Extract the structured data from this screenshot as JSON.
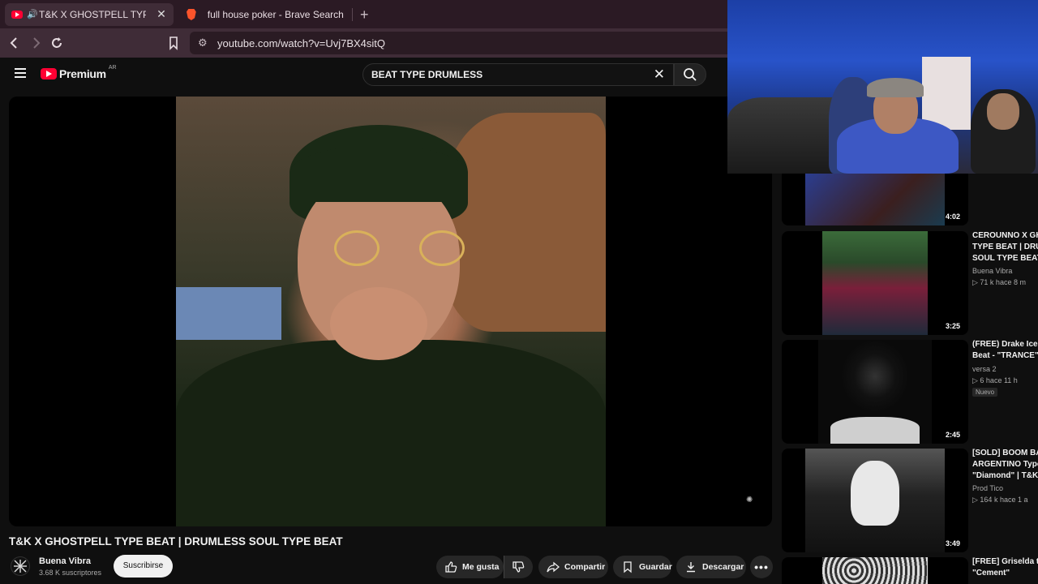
{
  "browser": {
    "tabs": [
      {
        "label": "T&K X GHOSTPELL TYPE BEAT"
      },
      {
        "label": "full house poker - Brave Search"
      }
    ],
    "url": "youtube.com/watch?v=Uvj7BX4sitQ"
  },
  "youtube": {
    "logo_text": "Premium",
    "country_code": "AR",
    "search_query": "BEAT TYPE DRUMLESS"
  },
  "video": {
    "title": "T&K X GHOSTPELL TYPE BEAT | DRUMLESS SOUL TYPE BEAT",
    "channel": "Buena Vibra",
    "subscribers": "3.68 K suscriptores",
    "subscribe_label": "Suscribirse",
    "actions": {
      "like": "Me gusta",
      "share": "Compartir",
      "save": "Guardar",
      "download": "Descargar"
    }
  },
  "recommendations": [
    {
      "title": "",
      "channel": "",
      "meta": "",
      "duration": "4:02"
    },
    {
      "title": "CEROUNNO X GHO",
      "title2": "TYPE BEAT | DRUM",
      "title3": "SOUL TYPE BEAT",
      "channel": "Buena Vibra",
      "meta": "▷ 71 k   hace 8 m",
      "duration": "3:25"
    },
    {
      "title": "(FREE) Drake Icem",
      "title2": "Beat - \"TRANCE\"",
      "channel": "versa 2",
      "meta": "▷ 6   hace 11 h",
      "badge": "Nuevo",
      "duration": "2:45"
    },
    {
      "title": "[SOLD] BOOM BAP",
      "title2": "ARGENTINO Type",
      "title3": "\"Diamond\" | T&K x",
      "channel": "Prod Tico",
      "meta": "▷ 164 k   hace 1 a",
      "duration": "3:49"
    },
    {
      "title": "[FREE] Griselda typ",
      "title2": "\"Cement\"",
      "channel": "",
      "meta": "",
      "duration": ""
    }
  ],
  "colors": {
    "accent_red": "#ff0033",
    "bg": "#0f0f0f",
    "chrome_tabbar": "#2b1a24",
    "chrome_urlbar": "#3f2c37"
  }
}
